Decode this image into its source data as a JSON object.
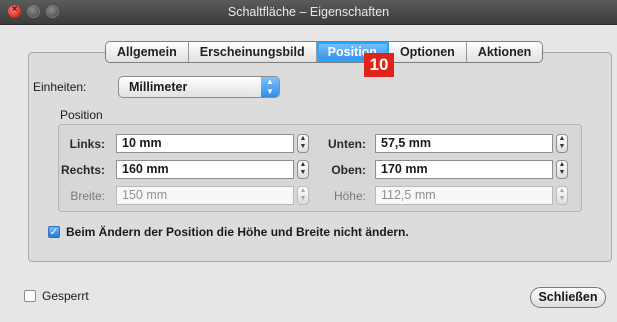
{
  "window": {
    "title": "Schaltfläche – Eigenschaften"
  },
  "tabs": [
    "Allgemein",
    "Erscheinungsbild",
    "Position",
    "Optionen",
    "Aktionen"
  ],
  "active_tab": "Position",
  "annotation_badge": "10",
  "units": {
    "label": "Einheiten:",
    "value": "Millimeter"
  },
  "position": {
    "group_label": "Position",
    "left": {
      "label": "Links:",
      "value": "10 mm"
    },
    "right": {
      "label": "Rechts:",
      "value": "160 mm"
    },
    "width": {
      "label": "Breite:",
      "value": "150 mm"
    },
    "bottom": {
      "label": "Unten:",
      "value": "57,5 mm"
    },
    "top": {
      "label": "Oben:",
      "value": "170 mm"
    },
    "height": {
      "label": "Höhe:",
      "value": "112,5 mm"
    }
  },
  "keep_size": {
    "label": "Beim Ändern der Position die Höhe und Breite nicht ändern.",
    "checked": true
  },
  "locked": {
    "label": "Gesperrt",
    "checked": false
  },
  "close_button": "Schließen"
}
